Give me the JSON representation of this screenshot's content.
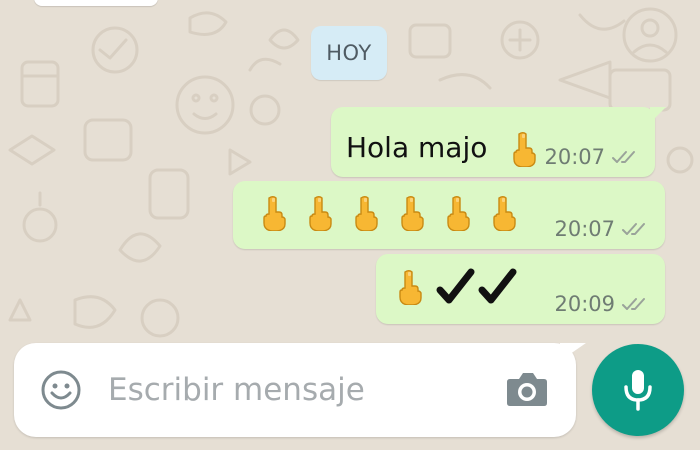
{
  "date_divider": {
    "label": "HOY"
  },
  "messages": [
    {
      "text": "Hola majo",
      "emoji": "🖕",
      "time": "20:07",
      "status": "read"
    },
    {
      "emoji_row": [
        "🖕",
        "🖕",
        "🖕",
        "🖕",
        "🖕",
        "🖕"
      ],
      "time": "20:07",
      "status": "read"
    },
    {
      "emoji": "🖕",
      "checks": "✔✔",
      "time": "20:09",
      "status": "read"
    }
  ],
  "composer": {
    "placeholder": "Escribir mensaje",
    "value": "",
    "emoji_icon": "smiley-icon",
    "camera_icon": "camera-icon",
    "mic_icon": "mic-icon"
  },
  "colors": {
    "wallpaper": "#e6dfd4",
    "outgoing_bubble": "#dcf8c6",
    "date_chip": "#d6ecf6",
    "mic_button": "#0d9c87"
  }
}
